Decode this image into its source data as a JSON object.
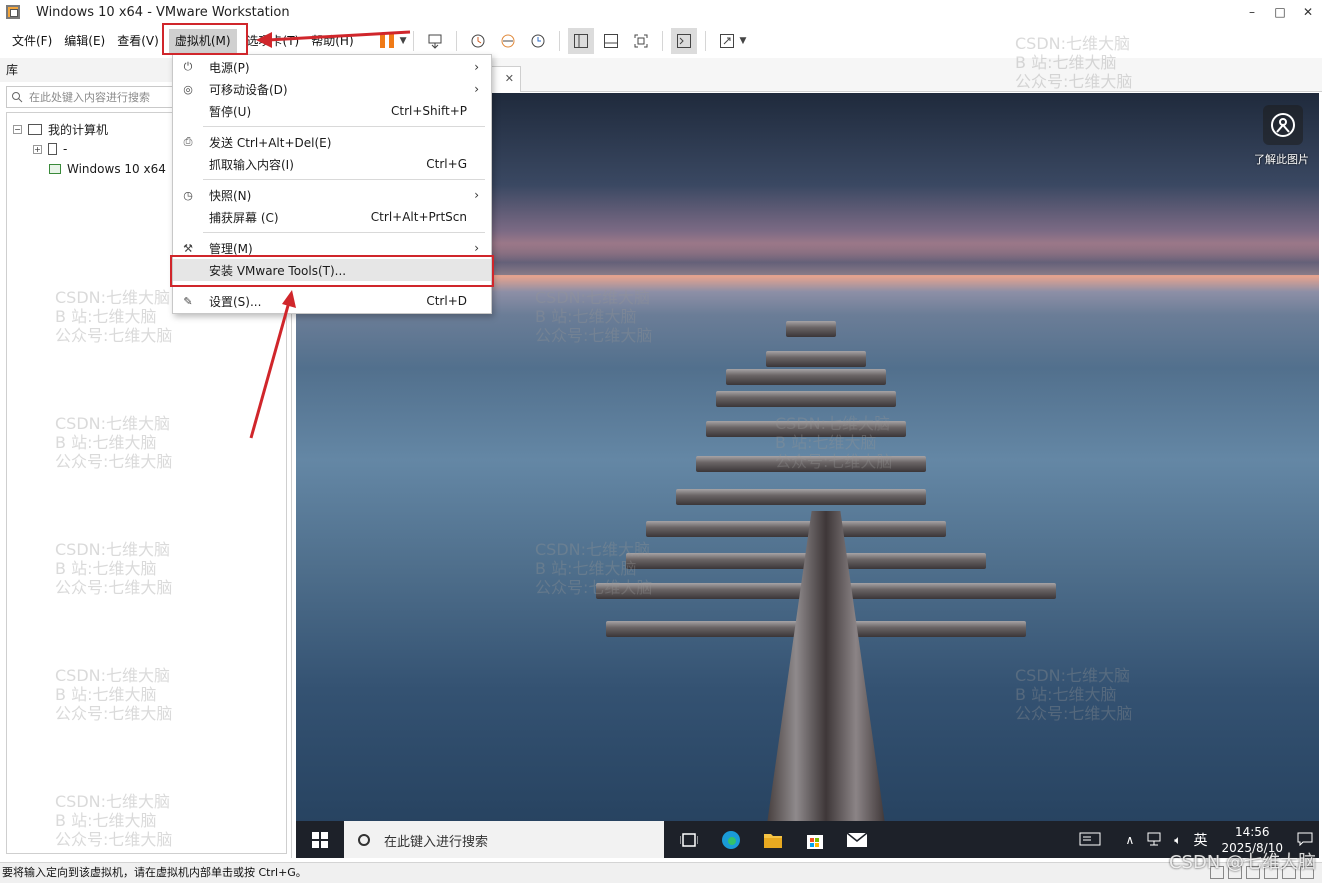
{
  "window": {
    "title": "Windows 10 x64 - VMware Workstation",
    "controls": [
      "–",
      "□",
      "✕"
    ]
  },
  "menubar": {
    "items": [
      "文件(F)",
      "编辑(E)",
      "查看(V)",
      "虚拟机(M)",
      "选项卡(T)",
      "帮助(H)"
    ],
    "active": "虚拟机(M)"
  },
  "library": {
    "header": "库",
    "search_placeholder": "在此处键入内容进行搜索",
    "tree": {
      "root": "我的计算机",
      "child1": "-",
      "child2": "Windows 10 x64"
    }
  },
  "vm_menu": {
    "power": "电源(P)",
    "removable": "可移动设备(D)",
    "pause": "暂停(U)",
    "pause_shortcut": "Ctrl+Shift+P",
    "send_cad": "发送 Ctrl+Alt+Del(E)",
    "grab_input": "抓取输入内容(I)",
    "grab_shortcut": "Ctrl+G",
    "snapshot": "快照(N)",
    "capture_screen": "捕获屏幕 (C)",
    "capture_shortcut": "Ctrl+Alt+PrtScn",
    "manage": "管理(M)",
    "install_tools": "安装 VMware Tools(T)...",
    "settings": "设置(S)...",
    "settings_shortcut": "Ctrl+D"
  },
  "vm_tab": {
    "label_fragment": "4",
    "close": "✕"
  },
  "guest": {
    "widget_label": "了解此图片",
    "search_text": "在此键入进行搜索",
    "tray_lang": "英",
    "time": "14:56",
    "date": "2025/8/10"
  },
  "statusbar": {
    "text": "要将输入定向到该虚拟机，请在虚拟机内部单击或按 Ctrl+G。"
  },
  "watermark": {
    "line1": "CSDN:七维大脑",
    "line2": "B 站:七维大脑",
    "line3": "公众号:七维大脑",
    "corner": "CSDN @七维大脑"
  },
  "colors": {
    "highlight": "#d0262b",
    "pause_orange": "#f07a17",
    "taskbar": "#1d2129"
  }
}
